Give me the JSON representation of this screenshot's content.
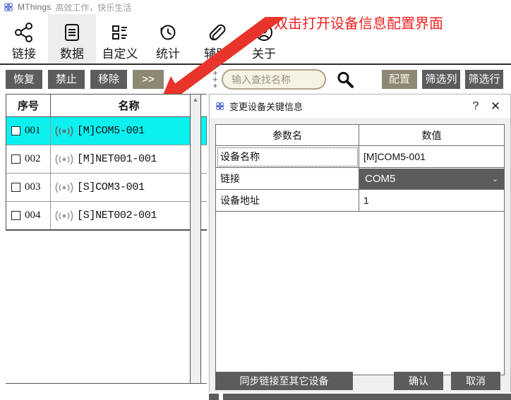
{
  "brand": {
    "logo_icon": "mthings-logo-icon",
    "name": "MThings",
    "slogan": "高效工作，快乐生活"
  },
  "ribbon": {
    "items": [
      {
        "label": "链接",
        "icon": "share-nodes-icon",
        "active": false
      },
      {
        "label": "数据",
        "icon": "document-lines-icon",
        "active": true
      },
      {
        "label": "自定义",
        "icon": "list-blocks-icon",
        "active": false
      },
      {
        "label": "统计",
        "icon": "clock-history-icon",
        "active": false
      },
      {
        "label": "辅助",
        "icon": "paperclip-icon",
        "active": false
      },
      {
        "label": "关于",
        "icon": "user-circle-icon",
        "active": false
      }
    ]
  },
  "annotation": {
    "text": "双击打开设备信息配置界面",
    "color": "#ee2222",
    "arrow_icon": "red-arrow-icon"
  },
  "toolbar": {
    "left_buttons": [
      {
        "label": "恢复",
        "style": "gray"
      },
      {
        "label": "禁止",
        "style": "gray"
      },
      {
        "label": "移除",
        "style": "gray"
      },
      {
        "label": ">>",
        "style": "khaki"
      }
    ],
    "splitter_icon": "splitter-grip-icon",
    "search": {
      "value": "",
      "placeholder": "输入查找名称",
      "icon": "search-icon"
    },
    "right_buttons": [
      {
        "label": "配置",
        "style": "khaki"
      },
      {
        "label": "筛选列",
        "style": "gray"
      },
      {
        "label": "筛选行",
        "style": "gray"
      }
    ]
  },
  "device_list": {
    "columns": [
      "序号",
      "名称"
    ],
    "scrollbar_up_icon": "chevron-up-icon",
    "rows": [
      {
        "seq": "001",
        "name": "[M]COM5-001",
        "icon": "signal-waves-icon",
        "checked": false,
        "selected": true
      },
      {
        "seq": "002",
        "name": "[M]NET001-001",
        "icon": "signal-waves-icon",
        "checked": false,
        "selected": false
      },
      {
        "seq": "003",
        "name": "[S]COM3-001",
        "icon": "signal-waves-icon",
        "checked": false,
        "selected": false
      },
      {
        "seq": "004",
        "name": "[S]NET002-001",
        "icon": "signal-waves-icon",
        "checked": false,
        "selected": false
      }
    ]
  },
  "dialog": {
    "logo_icon": "mthings-logo-icon",
    "title": "变更设备关键信息",
    "help_label": "?",
    "help_icon": "question-mark-icon",
    "close_label": "✕",
    "close_icon": "close-icon",
    "table": {
      "headers": [
        "参数名",
        "数值"
      ],
      "rows": [
        {
          "name": "设备名称",
          "value": "[M]COM5-001",
          "type": "text",
          "focused": true
        },
        {
          "name": "链接",
          "value": "COM5",
          "type": "combo",
          "caret_icon": "chevron-down-icon"
        },
        {
          "name": "设备地址",
          "value": "1",
          "type": "text",
          "focused": false
        }
      ]
    },
    "buttons": {
      "sync": "同步链接至其它设备",
      "ok": "确认",
      "cancel": "取消"
    }
  },
  "colors": {
    "selection": "#0df0f0",
    "gray_button": "#5c5c5c",
    "khaki_button": "#8d8874",
    "accent_red": "#ee2222",
    "dialog_bg": "#f0f0f0"
  }
}
